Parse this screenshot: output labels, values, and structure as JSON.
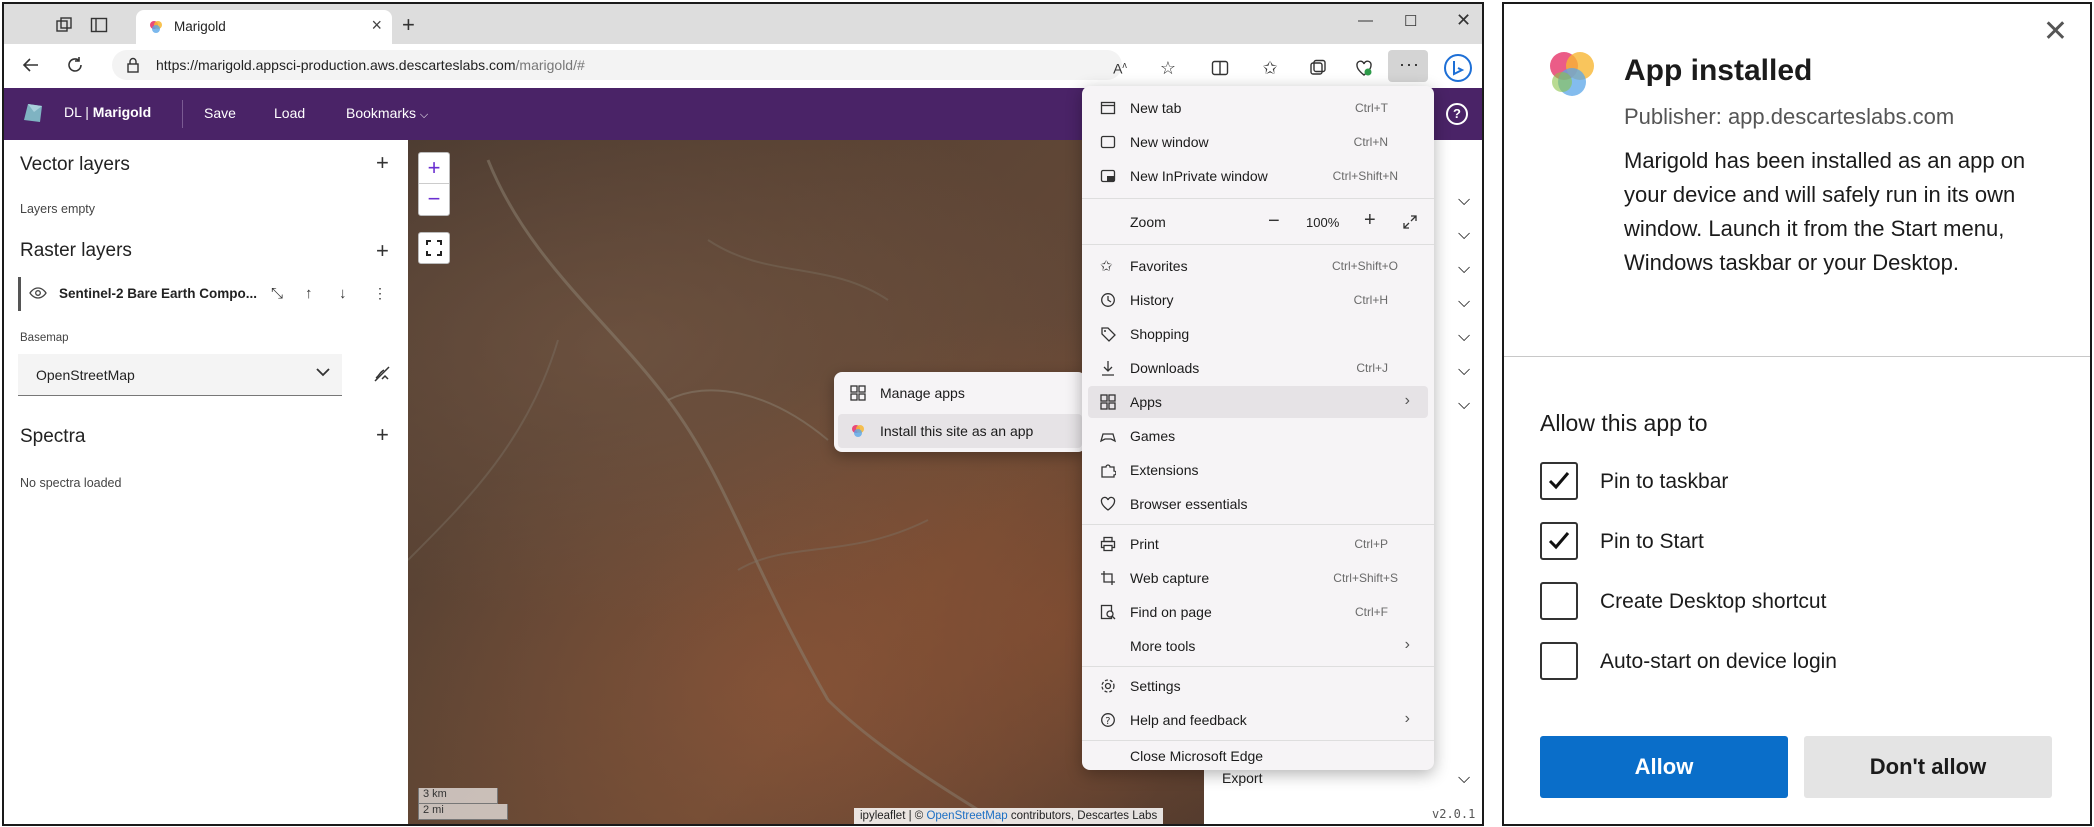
{
  "browser": {
    "tab_title": "Marigold",
    "url_host": "https://marigold.appsci-production.aws.descarteslabs.com",
    "url_path": "/marigold/#"
  },
  "app": {
    "brand_prefix": "DL | ",
    "brand_name": "Marigold",
    "nav": [
      "Save",
      "Load",
      "Bookmarks"
    ],
    "help": "?"
  },
  "left_panel": {
    "vector_title": "Vector layers",
    "vector_empty": "Layers empty",
    "raster_title": "Raster layers",
    "raster_layer": "Sentinel-2 Bare Earth Compo...",
    "basemap_label": "Basemap",
    "basemap_value": "OpenStreetMap",
    "spectra_title": "Spectra",
    "spectra_empty": "No spectra loaded",
    "plus": "+"
  },
  "map": {
    "zoom_in": "+",
    "zoom_out": "−",
    "scale_km": "3 km",
    "scale_mi": "2 mi",
    "attribution_prefix": "ipyleaflet | © ",
    "attribution_link": "OpenStreetMap",
    "attribution_suffix": " contributors, Descartes Labs"
  },
  "right_panel": {
    "export_label": "Export",
    "version": "v2.0.1"
  },
  "edge_menu": {
    "new_tab": {
      "label": "New tab",
      "shortcut": "Ctrl+T"
    },
    "new_window": {
      "label": "New window",
      "shortcut": "Ctrl+N"
    },
    "inprivate": {
      "label": "New InPrivate window",
      "shortcut": "Ctrl+Shift+N"
    },
    "zoom": {
      "label": "Zoom",
      "value": "100%"
    },
    "favorites": {
      "label": "Favorites",
      "shortcut": "Ctrl+Shift+O"
    },
    "history": {
      "label": "History",
      "shortcut": "Ctrl+H"
    },
    "shopping": {
      "label": "Shopping"
    },
    "downloads": {
      "label": "Downloads",
      "shortcut": "Ctrl+J"
    },
    "apps": {
      "label": "Apps"
    },
    "games": {
      "label": "Games"
    },
    "extensions": {
      "label": "Extensions"
    },
    "essentials": {
      "label": "Browser essentials"
    },
    "print": {
      "label": "Print",
      "shortcut": "Ctrl+P"
    },
    "web_capture": {
      "label": "Web capture",
      "shortcut": "Ctrl+Shift+S"
    },
    "find": {
      "label": "Find on page",
      "shortcut": "Ctrl+F"
    },
    "more_tools": {
      "label": "More tools"
    },
    "settings": {
      "label": "Settings"
    },
    "help": {
      "label": "Help and feedback"
    },
    "close": {
      "label": "Close Microsoft Edge"
    }
  },
  "apps_submenu": {
    "manage": "Manage apps",
    "install": "Install this site as an app"
  },
  "dialog": {
    "title": "App installed",
    "publisher": "Publisher: app.descarteslabs.com",
    "message": "Marigold has been installed as an app on your device and will safely run in its own window. Launch it from the Start menu, Windows taskbar or your Desktop.",
    "allow_heading": "Allow this app to",
    "options": [
      {
        "label": "Pin to taskbar",
        "checked": true
      },
      {
        "label": "Pin to Start",
        "checked": true
      },
      {
        "label": "Create Desktop shortcut",
        "checked": false
      },
      {
        "label": "Auto-start on device login",
        "checked": false
      }
    ],
    "allow_button": "Allow",
    "deny_button": "Don't allow",
    "close": "✕"
  },
  "colors": {
    "app_header": "#4a2367",
    "allow_blue": "#0a6ec9",
    "zoom_purple": "#6a2fd1"
  }
}
